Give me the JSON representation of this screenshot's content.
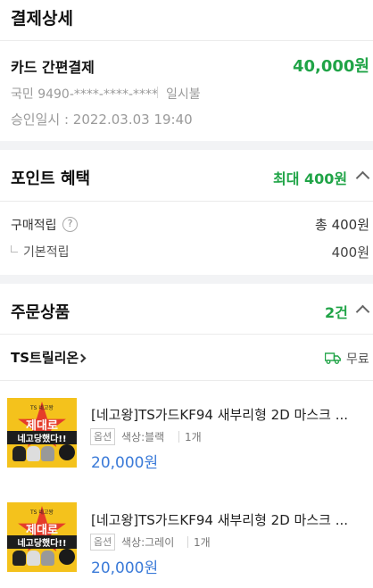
{
  "payment": {
    "title": "결제상세",
    "method_label": "카드 간편결제",
    "amount": "40,000원",
    "card_info": "국민 9490-****-****-****",
    "installment": "일시불",
    "approved_at": "승인일시 : 2022.03.03 19:40"
  },
  "points": {
    "title": "포인트 혜택",
    "max": "최대 400원",
    "purchase_label": "구매적립",
    "help_glyph": "?",
    "purchase_total": "총 400원",
    "basic_label": "기본적립",
    "basic_value": "400원"
  },
  "order": {
    "title": "주문상품",
    "count": "2건",
    "seller": "TS트릴리온",
    "shipping": "무료",
    "items": [
      {
        "name": "[네고왕]TS가드KF94 새부리형 2D 마스크 ...",
        "option_tag": "옵션",
        "option": "색상:블랙",
        "qty": "1개",
        "price": "20,000원",
        "thumb_line1": "제대로",
        "thumb_line2": "네고당했다!!",
        "thumb_brand": "TS 네고왕"
      },
      {
        "name": "[네고왕]TS가드KF94 새부리형 2D 마스크 ...",
        "option_tag": "옵션",
        "option": "색상:그레이",
        "qty": "1개",
        "price": "20,000원",
        "thumb_line1": "제대로",
        "thumb_line2": "네고당했다!!",
        "thumb_brand": "TS 네고왕"
      }
    ]
  },
  "colors": {
    "accent_green": "#20a447",
    "price_blue": "#3a7ad8",
    "background": "#f2f3f5"
  }
}
